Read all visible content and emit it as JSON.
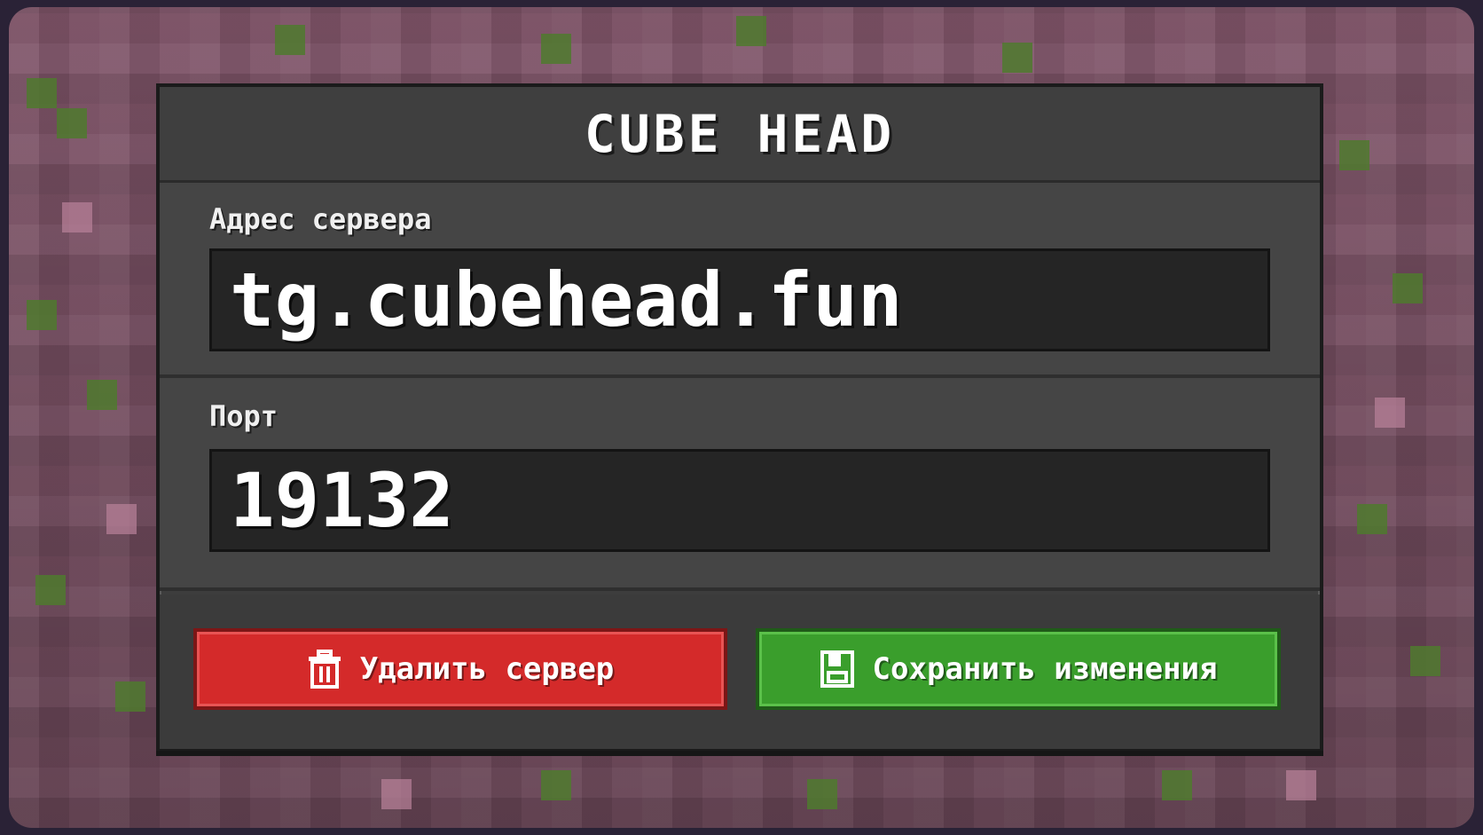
{
  "dialog": {
    "title": "CUBE HEAD"
  },
  "server_address": {
    "label": "Адрес сервера",
    "value": "tg.cubehead.fun"
  },
  "port": {
    "label": "Порт",
    "value": "19132"
  },
  "actions": {
    "delete_label": "Удалить сервер",
    "delete_icon": "trash-icon",
    "save_label": "Сохранить изменения",
    "save_icon": "save-icon"
  },
  "colors": {
    "delete_button": "#d42a2a",
    "save_button": "#3a9e2c",
    "panel": "#3d3d3d"
  }
}
